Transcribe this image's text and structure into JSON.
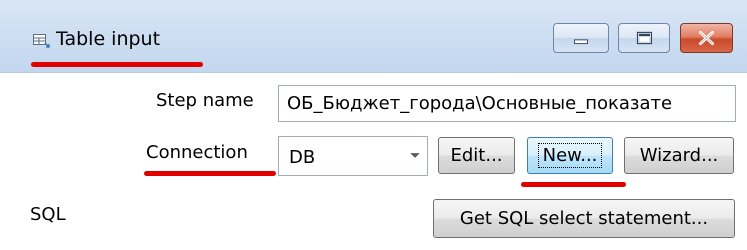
{
  "window": {
    "title": "Table input",
    "icon": "table-input-icon",
    "controls": [
      "minimize-icon",
      "maximize-icon",
      "close-icon"
    ]
  },
  "form": {
    "step_name_label": "Step name",
    "step_name_value": "ОБ_Бюджет_города\\Основные_показате",
    "connection_label": "Connection",
    "connection_value": "DB",
    "sql_label": "SQL"
  },
  "buttons": {
    "edit": "Edit...",
    "new": "New...",
    "wizard": "Wizard...",
    "get_sql": "Get SQL select statement..."
  },
  "colors": {
    "titlebar": "#cfdff2",
    "highlight_underline": "#e00000",
    "close_button": "#c94a2b",
    "focused_button": "#bee6fd"
  }
}
